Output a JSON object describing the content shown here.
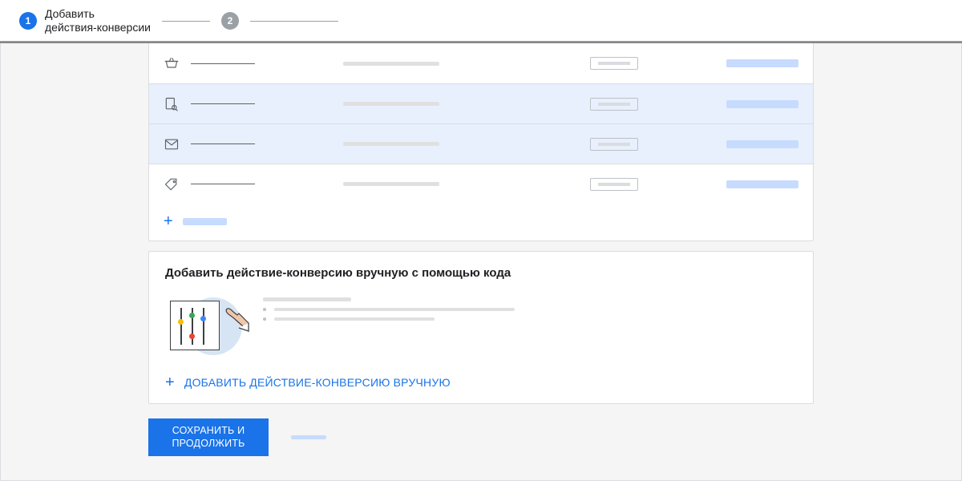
{
  "stepper": {
    "step1": {
      "number": "1",
      "label": "Добавить\nдействия-конверсии"
    },
    "step2": {
      "number": "2"
    }
  },
  "rows": [
    {
      "icon": "basket-icon",
      "selected": false
    },
    {
      "icon": "search-page-icon",
      "selected": true
    },
    {
      "icon": "mail-icon",
      "selected": true
    },
    {
      "icon": "tag-icon",
      "selected": false
    }
  ],
  "manual": {
    "title": "Добавить действие-конверсию вручную с помощью кода",
    "action": "ДОБАВИТЬ ДЕЙСТВИЕ-КОНВЕРСИЮ ВРУЧНУЮ"
  },
  "footer": {
    "primary": "СОХРАНИТЬ И\nПРОДОЛЖИТЬ"
  }
}
